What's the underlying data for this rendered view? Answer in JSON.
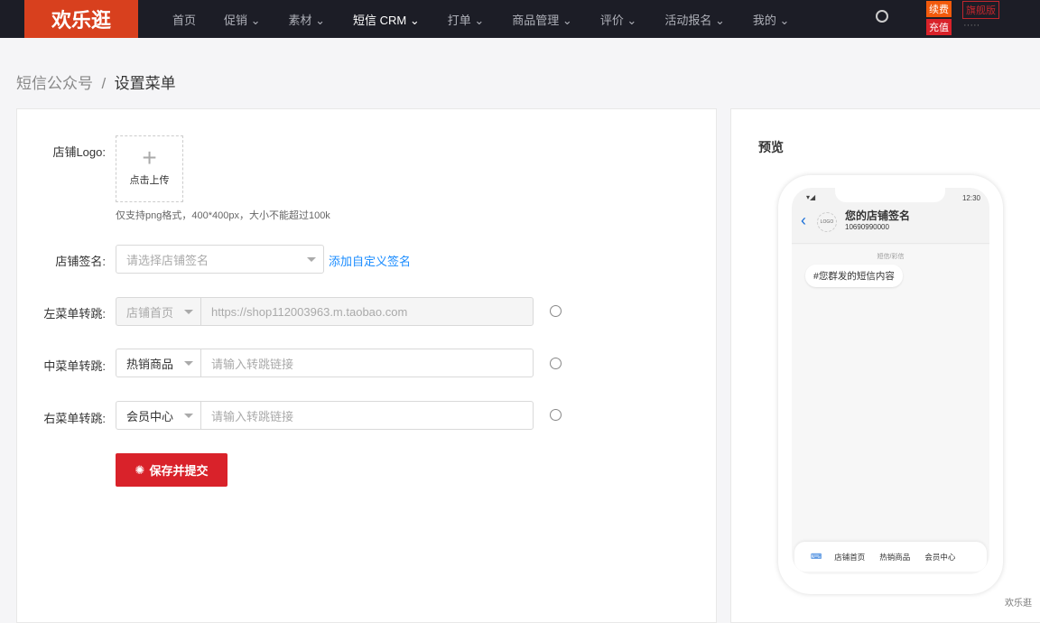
{
  "header": {
    "logo": "欢乐逛",
    "nav": [
      "首页",
      "促销 ⌄",
      "素材 ⌄",
      "短信 CRM ⌄",
      "打单 ⌄",
      "商品管理 ⌄",
      "评价 ⌄",
      "活动报名 ⌄",
      "我的 ⌄"
    ],
    "renew": "续费",
    "flagship": "旗舰版",
    "recharge": "充值",
    "user": "·····"
  },
  "breadcrumb": {
    "parent": "短信公众号",
    "sep": "/",
    "current": "设置菜单"
  },
  "form": {
    "logo_label": "店铺Logo:",
    "upload_label": "点击上传",
    "upload_hint": "仅支持png格式，400*400px，大小不能超过100k",
    "sign_label": "店铺签名:",
    "sign_placeholder": "请选择店铺签名",
    "add_sign": "添加自定义签名",
    "left_label": "左菜单转跳:",
    "left_type": "店铺首页",
    "left_url": "https://shop112003963.m.taobao.com",
    "mid_label": "中菜单转跳:",
    "mid_type": "热销商品",
    "mid_placeholder": "请输入转跳链接",
    "right_label": "右菜单转跳:",
    "right_type": "会员中心",
    "right_placeholder": "请输入转跳链接",
    "submit": "保存并提交"
  },
  "preview": {
    "title": "预览",
    "time": "12:30",
    "logo": "LOGO",
    "sign": "您的店铺签名",
    "number": "10690990000",
    "type": "短信/彩信",
    "message": "#您群发的短信内容",
    "menu": [
      "店铺首页",
      "热销商品",
      "会员中心"
    ]
  },
  "watermark": "欢乐逛"
}
